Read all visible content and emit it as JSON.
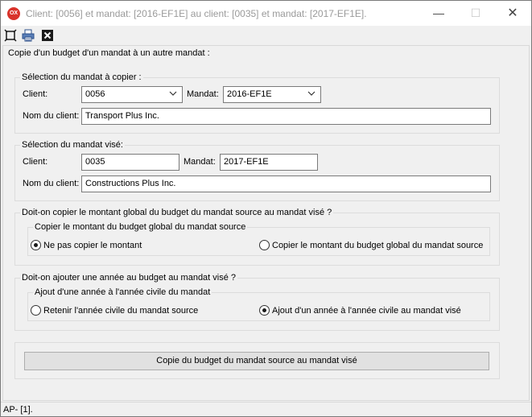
{
  "window": {
    "app_icon_text": "OX",
    "title": "Client: [0056]  et mandat: [2016-EF1E]  au client: [0035]  et mandat: [2017-EF1E].",
    "minimize": "—",
    "maximize": "☐",
    "close": "✕"
  },
  "toolbar": {
    "icons": [
      "fit-window-icon",
      "print-icon",
      "close-icon"
    ]
  },
  "main": {
    "title": "Copie d'un budget d'un mandat à un autre mandat :"
  },
  "source": {
    "legend": "Sélection du mandat à copier :",
    "client_label": "Client:",
    "client_value": "0056",
    "mandat_label": "Mandat:",
    "mandat_value": "2016-EF1E",
    "nom_label": "Nom du client:",
    "nom_value": "Transport Plus Inc."
  },
  "target": {
    "legend": "Sélection du mandat visé:",
    "client_label": "Client:",
    "client_value": "0035",
    "mandat_label": "Mandat:",
    "mandat_value": "2017-EF1E",
    "nom_label": "Nom du client:",
    "nom_value": "Constructions Plus  Inc."
  },
  "budget_question": {
    "legend": "Doit-on copier le montant global du budget du mandat source au mandat visé ?",
    "inner_legend": "Copier le montant du budget global du mandat source",
    "option_no": "Ne pas copier le montant",
    "option_yes": "Copier le montant du budget global du mandat source",
    "selected": "option_no"
  },
  "year_question": {
    "legend": "Doit-on ajouter une année au budget au mandat visé ?",
    "inner_legend": "Ajout d'une année à l'année civile du mandat",
    "option_keep": "Retenir l'année civile du mandat source",
    "option_add": "Ajout d'un année à l'année civile au mandat visé",
    "selected": "option_add"
  },
  "action": {
    "label": "Copie du budget du mandat source au mandat visé"
  },
  "status": {
    "text": "AP- [1]."
  }
}
